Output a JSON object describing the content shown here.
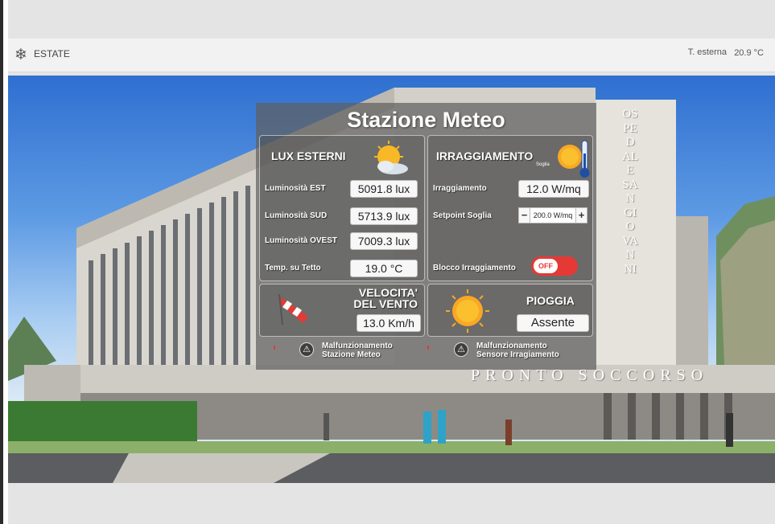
{
  "topbar": {
    "season_icon": "snowflake-icon",
    "season_label": "ESTATE",
    "temp_label": "T. esterna",
    "temp_value": "20.9 °C"
  },
  "scene": {
    "hospital_sign_vertical": "OSPEDALE SAN GIOVANNI",
    "er_sign": "PRONTO SOCCORSO"
  },
  "panel": {
    "title": "Stazione Meteo",
    "lux": {
      "title": "LUX ESTERNI",
      "icon": "sun-cloud-icon",
      "rows": [
        {
          "label": "Luminosità EST",
          "value": "5091.8 lux"
        },
        {
          "label": "Luminosità SUD",
          "value": "5713.9 lux"
        },
        {
          "label": "Luminosità OVEST",
          "value": "7009.3 lux"
        },
        {
          "label": "Temp. su Tetto",
          "value": "19.0 °C"
        }
      ]
    },
    "irr": {
      "title": "IRRAGGIAMENTO",
      "sub": "Soglia",
      "icon": "sun-thermometer-icon",
      "irr_label": "Irraggiamento",
      "irr_value": "12.0 W/mq",
      "setpoint_label": "Setpoint Soglia",
      "setpoint_value": "200.0 W/mq",
      "minus": "−",
      "plus": "+",
      "block_label": "Blocco Irraggiamento",
      "block_state": "OFF"
    },
    "wind": {
      "title_1": "VELOCITA'",
      "title_2": "DEL VENTO",
      "icon": "windsock-icon",
      "value": "13.0 Km/h"
    },
    "rain": {
      "title": "PIOGGIA",
      "icon": "sun-icon",
      "value": "Assente"
    },
    "alerts": [
      {
        "line1": "Malfunzionamento",
        "line2": "Stazione Meteo"
      },
      {
        "line1": "Malfunzionamento",
        "line2": "Sensore Irragiamento"
      }
    ]
  },
  "colors": {
    "toggle_off": "#e53935",
    "panel_bg": "#5f5f5f",
    "topbar_bg": "#f2f2f2"
  }
}
